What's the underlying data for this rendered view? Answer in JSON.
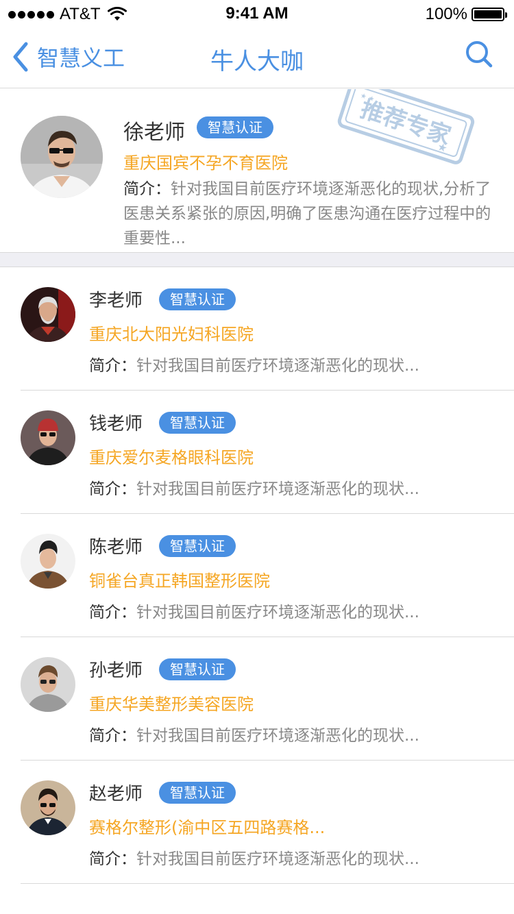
{
  "status_bar": {
    "carrier": "AT&T",
    "time": "9:41 AM",
    "battery": "100%"
  },
  "nav": {
    "back_label": "智慧义工",
    "title": "牛人大咖"
  },
  "featured": {
    "name": "徐老师",
    "badge": "智慧认证",
    "hospital": "重庆国宾不孕不育医院",
    "desc_label": "简介：",
    "desc_text": "针对我国目前医疗环境逐渐恶化的现状,分析了医患关系紧张的原因,明确了医患沟通在医疗过程中的重要性...",
    "stamp_text": "推荐专家"
  },
  "list": [
    {
      "name": "李老师",
      "badge": "智慧认证",
      "hospital": "重庆北大阳光妇科医院",
      "desc_label": "简介：",
      "desc_text": "针对我国目前医疗环境逐渐恶化的现状..."
    },
    {
      "name": "钱老师",
      "badge": "智慧认证",
      "hospital": "重庆爱尔麦格眼科医院",
      "desc_label": "简介：",
      "desc_text": "针对我国目前医疗环境逐渐恶化的现状..."
    },
    {
      "name": "陈老师",
      "badge": "智慧认证",
      "hospital": "铜雀台真正韩国整形医院",
      "desc_label": "简介：",
      "desc_text": "针对我国目前医疗环境逐渐恶化的现状..."
    },
    {
      "name": "孙老师",
      "badge": "智慧认证",
      "hospital": "重庆华美整形美容医院",
      "desc_label": "简介：",
      "desc_text": "针对我国目前医疗环境逐渐恶化的现状..."
    },
    {
      "name": "赵老师",
      "badge": "智慧认证",
      "hospital": "赛格尔整形(渝中区五四路赛格...",
      "desc_label": "简介：",
      "desc_text": "针对我国目前医疗环境逐渐恶化的现状..."
    }
  ],
  "colors": {
    "accent": "#4a90e2",
    "hospital": "#f5a623",
    "muted": "#888888"
  },
  "icons": {
    "back": "chevron-left-icon",
    "search": "search-icon",
    "wifi": "wifi-icon",
    "battery": "battery-icon"
  }
}
